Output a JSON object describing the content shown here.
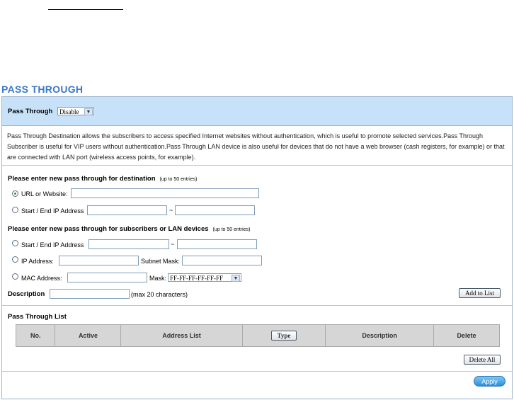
{
  "title": "PASS THROUGH",
  "pass_through": {
    "label": "Pass Through",
    "value": "Disable"
  },
  "description": "Pass Through Destination allows the subscribers to access specified Internet websites without authentication, which is useful to promote selected services.Pass Through Subscriber is useful for VIP users without authentication.Pass Through LAN device is also useful for devices that do not have a web browser (cash registers, for example) or that are connected with LAN port (wireless access points, for example).",
  "destination": {
    "heading": "Please enter new pass through for destination",
    "limit": "(up to 50 entries)",
    "url_label": "URL or Website:",
    "ip_range_label": "Start / End IP Address",
    "separator": "~"
  },
  "subscribers": {
    "heading": "Please enter new pass through for subscribers or LAN devices",
    "limit": "(up to 50 entries)",
    "ip_range_label": "Start / End IP Address",
    "separator": "~",
    "ip_label": "IP Address:",
    "subnet_label": "Subnet Mask:",
    "mac_label": "MAC Address:",
    "mask_label": "Mask:",
    "mask_value": "FF-FF-FF-FF-FF-FF",
    "desc_label": "Description",
    "desc_hint": "(max 20 characters)",
    "add_button": "Add to List"
  },
  "list": {
    "heading": "Pass Through List",
    "columns": [
      "No.",
      "Active",
      "Address List",
      "Type",
      "Description",
      "Delete"
    ],
    "delete_all": "Delete All"
  },
  "apply": "Apply",
  "colors": {
    "title": "#3a78c8",
    "band": "#c7e2f8",
    "apply": "#2c8ed8"
  }
}
